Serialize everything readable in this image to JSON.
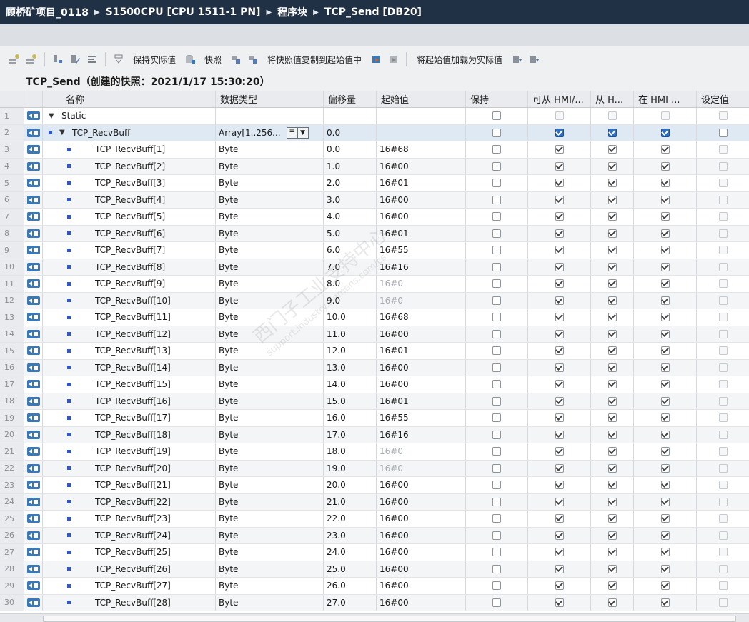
{
  "breadcrumb": [
    "顾桥矿项目_0118",
    "S1500CPU [CPU 1511-1 PN]",
    "程序块",
    "TCP_Send [DB20]"
  ],
  "toolbar": {
    "keep_actual": "保持实际值",
    "snapshot": "快照",
    "copy_snapshot": "将快照值复制到起始值中",
    "load_start": "将起始值加载为实际值"
  },
  "snapshot_title": "TCP_Send（创建的快照：2021/1/17 15:30:20）",
  "columns": {
    "name": "名称",
    "type": "数据类型",
    "offset": "偏移量",
    "start": "起始值",
    "retain": "保持",
    "hmi_access": "可从 HMI/...",
    "hmi_from": "从 H...",
    "hmi_in": "在 HMI ...",
    "setpoint": "设定值"
  },
  "rows": [
    {
      "num": "1",
      "name": "Static",
      "type": "",
      "offset": "",
      "start": "",
      "level": 0,
      "kind": "static"
    },
    {
      "num": "2",
      "name": "TCP_RecvBuff",
      "type": "Array[1..256...",
      "offset": "0.0",
      "start": "",
      "level": 1,
      "kind": "array"
    },
    {
      "num": "3",
      "name": "TCP_RecvBuff[1]",
      "type": "Byte",
      "offset": "0.0",
      "start": "16#68",
      "level": 2,
      "kind": "elem"
    },
    {
      "num": "4",
      "name": "TCP_RecvBuff[2]",
      "type": "Byte",
      "offset": "1.0",
      "start": "16#00",
      "level": 2,
      "kind": "elem"
    },
    {
      "num": "5",
      "name": "TCP_RecvBuff[3]",
      "type": "Byte",
      "offset": "2.0",
      "start": "16#01",
      "level": 2,
      "kind": "elem"
    },
    {
      "num": "6",
      "name": "TCP_RecvBuff[4]",
      "type": "Byte",
      "offset": "3.0",
      "start": "16#00",
      "level": 2,
      "kind": "elem"
    },
    {
      "num": "7",
      "name": "TCP_RecvBuff[5]",
      "type": "Byte",
      "offset": "4.0",
      "start": "16#00",
      "level": 2,
      "kind": "elem"
    },
    {
      "num": "8",
      "name": "TCP_RecvBuff[6]",
      "type": "Byte",
      "offset": "5.0",
      "start": "16#01",
      "level": 2,
      "kind": "elem"
    },
    {
      "num": "9",
      "name": "TCP_RecvBuff[7]",
      "type": "Byte",
      "offset": "6.0",
      "start": "16#55",
      "level": 2,
      "kind": "elem"
    },
    {
      "num": "10",
      "name": "TCP_RecvBuff[8]",
      "type": "Byte",
      "offset": "7.0",
      "start": "16#16",
      "level": 2,
      "kind": "elem"
    },
    {
      "num": "11",
      "name": "TCP_RecvBuff[9]",
      "type": "Byte",
      "offset": "8.0",
      "start": "16#0",
      "level": 2,
      "kind": "elem",
      "gray": true
    },
    {
      "num": "12",
      "name": "TCP_RecvBuff[10]",
      "type": "Byte",
      "offset": "9.0",
      "start": "16#0",
      "level": 2,
      "kind": "elem",
      "gray": true
    },
    {
      "num": "13",
      "name": "TCP_RecvBuff[11]",
      "type": "Byte",
      "offset": "10.0",
      "start": "16#68",
      "level": 2,
      "kind": "elem"
    },
    {
      "num": "14",
      "name": "TCP_RecvBuff[12]",
      "type": "Byte",
      "offset": "11.0",
      "start": "16#00",
      "level": 2,
      "kind": "elem"
    },
    {
      "num": "15",
      "name": "TCP_RecvBuff[13]",
      "type": "Byte",
      "offset": "12.0",
      "start": "16#01",
      "level": 2,
      "kind": "elem"
    },
    {
      "num": "16",
      "name": "TCP_RecvBuff[14]",
      "type": "Byte",
      "offset": "13.0",
      "start": "16#00",
      "level": 2,
      "kind": "elem"
    },
    {
      "num": "17",
      "name": "TCP_RecvBuff[15]",
      "type": "Byte",
      "offset": "14.0",
      "start": "16#00",
      "level": 2,
      "kind": "elem"
    },
    {
      "num": "18",
      "name": "TCP_RecvBuff[16]",
      "type": "Byte",
      "offset": "15.0",
      "start": "16#01",
      "level": 2,
      "kind": "elem"
    },
    {
      "num": "19",
      "name": "TCP_RecvBuff[17]",
      "type": "Byte",
      "offset": "16.0",
      "start": "16#55",
      "level": 2,
      "kind": "elem"
    },
    {
      "num": "20",
      "name": "TCP_RecvBuff[18]",
      "type": "Byte",
      "offset": "17.0",
      "start": "16#16",
      "level": 2,
      "kind": "elem"
    },
    {
      "num": "21",
      "name": "TCP_RecvBuff[19]",
      "type": "Byte",
      "offset": "18.0",
      "start": "16#0",
      "level": 2,
      "kind": "elem",
      "gray": true
    },
    {
      "num": "22",
      "name": "TCP_RecvBuff[20]",
      "type": "Byte",
      "offset": "19.0",
      "start": "16#0",
      "level": 2,
      "kind": "elem",
      "gray": true
    },
    {
      "num": "23",
      "name": "TCP_RecvBuff[21]",
      "type": "Byte",
      "offset": "20.0",
      "start": "16#00",
      "level": 2,
      "kind": "elem"
    },
    {
      "num": "24",
      "name": "TCP_RecvBuff[22]",
      "type": "Byte",
      "offset": "21.0",
      "start": "16#00",
      "level": 2,
      "kind": "elem"
    },
    {
      "num": "25",
      "name": "TCP_RecvBuff[23]",
      "type": "Byte",
      "offset": "22.0",
      "start": "16#00",
      "level": 2,
      "kind": "elem"
    },
    {
      "num": "26",
      "name": "TCP_RecvBuff[24]",
      "type": "Byte",
      "offset": "23.0",
      "start": "16#00",
      "level": 2,
      "kind": "elem"
    },
    {
      "num": "27",
      "name": "TCP_RecvBuff[25]",
      "type": "Byte",
      "offset": "24.0",
      "start": "16#00",
      "level": 2,
      "kind": "elem"
    },
    {
      "num": "28",
      "name": "TCP_RecvBuff[26]",
      "type": "Byte",
      "offset": "25.0",
      "start": "16#00",
      "level": 2,
      "kind": "elem"
    },
    {
      "num": "29",
      "name": "TCP_RecvBuff[27]",
      "type": "Byte",
      "offset": "26.0",
      "start": "16#00",
      "level": 2,
      "kind": "elem"
    },
    {
      "num": "30",
      "name": "TCP_RecvBuff[28]",
      "type": "Byte",
      "offset": "27.0",
      "start": "16#00",
      "level": 2,
      "kind": "elem"
    }
  ],
  "watermark": "西门子工业支持中心",
  "watermark_url": "support.industry.siemens.com/cs",
  "colors": {
    "title_bg": "#203045",
    "accent": "#2f6fc0",
    "selected_row": "#dfe9f3"
  }
}
